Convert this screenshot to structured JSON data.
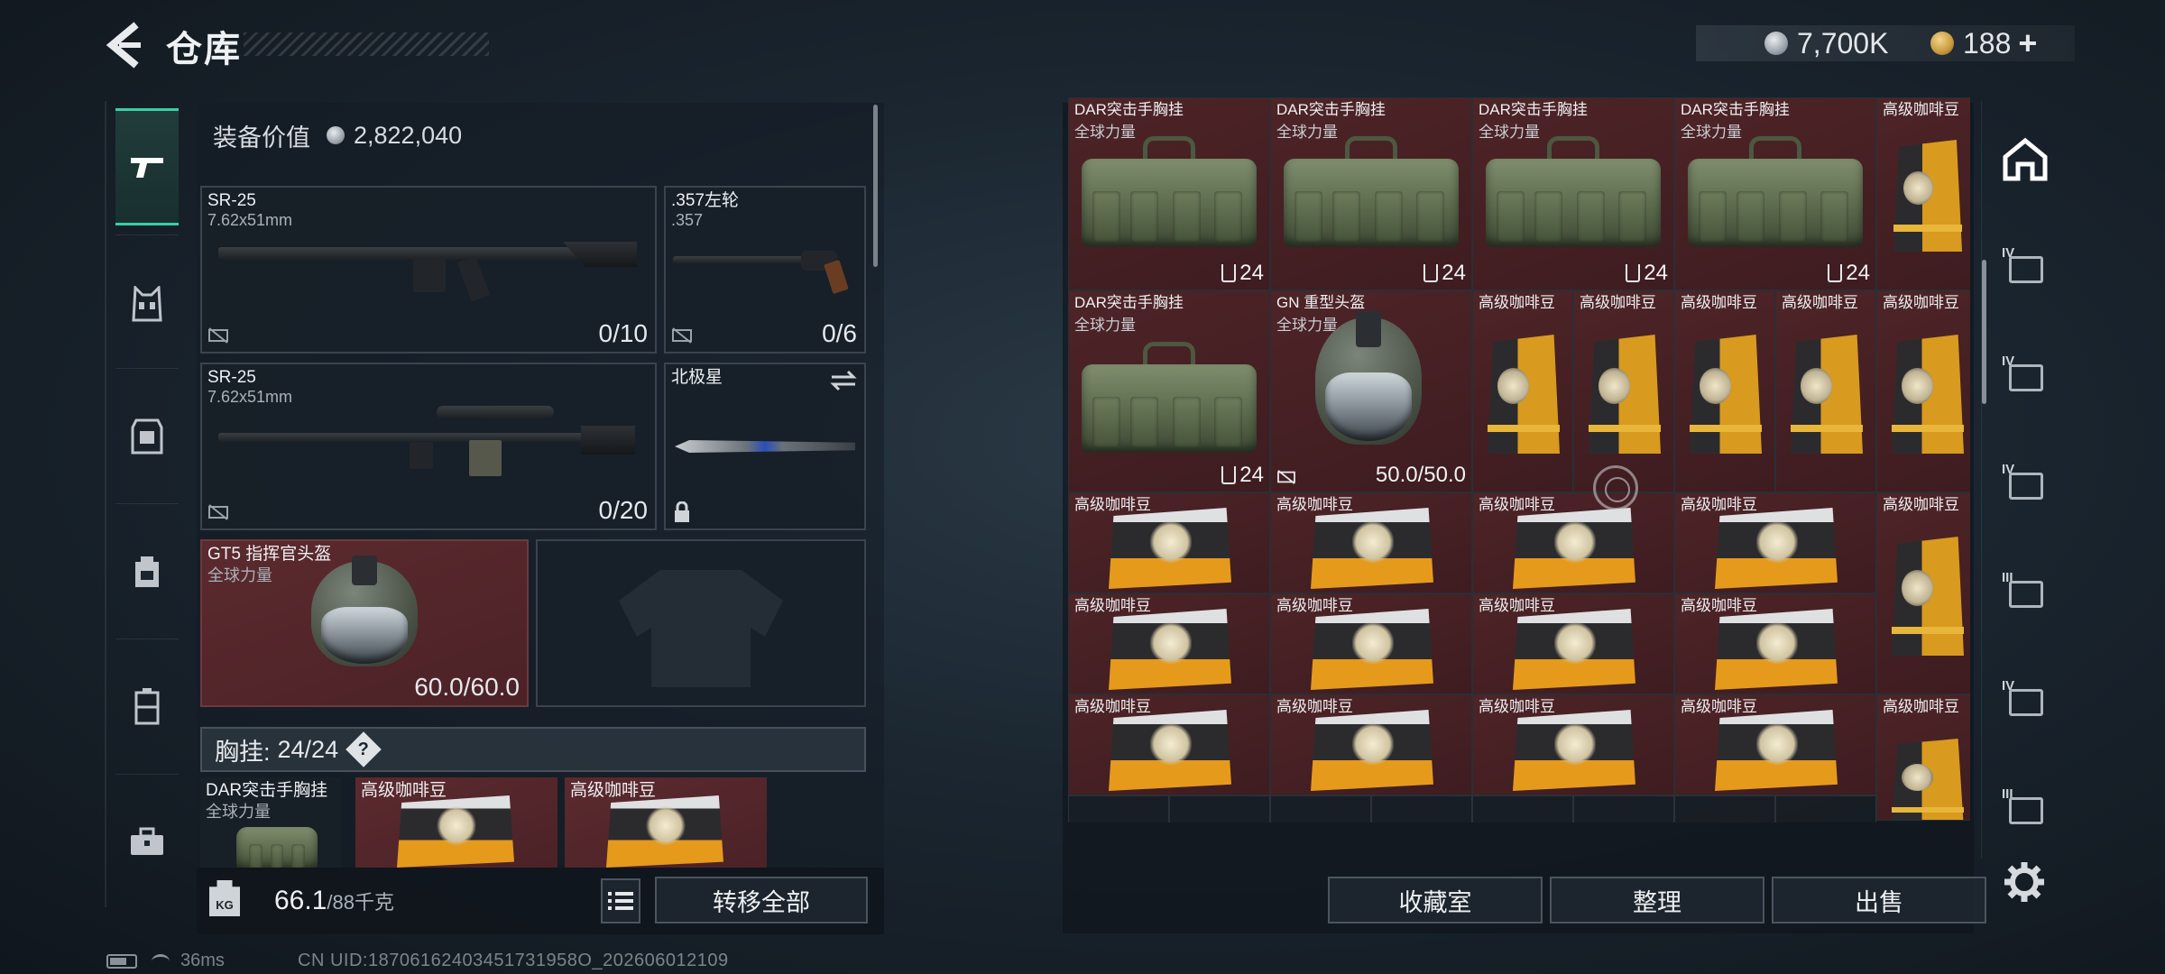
{
  "header": {
    "title": "仓库",
    "currency_silver": "7,700K",
    "currency_gold": "188",
    "plus_symbol": "+"
  },
  "equipment": {
    "value_label": "装备价值",
    "value": "2,822,040",
    "slots": [
      {
        "name": "SR-25",
        "sub": "7.62x51mm",
        "count": "0/10"
      },
      {
        "name": ".357左轮",
        "sub": ".357",
        "count": "0/6"
      },
      {
        "name": "SR-25",
        "sub": "7.62x51mm",
        "count": "0/20"
      },
      {
        "name": "北极星"
      },
      {
        "name": "GT5 指挥官头盔",
        "sub": "全球力量",
        "count": "60.0/60.0"
      }
    ],
    "rig_label": "胸挂:",
    "rig_count": "24/24",
    "rig_help": "?",
    "rig_items": [
      {
        "name": "DAR突击手胸挂",
        "sub": "全球力量"
      },
      {
        "name": "高级咖啡豆"
      },
      {
        "name": "高级咖啡豆"
      }
    ],
    "weight_badge": "KG",
    "weight_value": "66.1",
    "weight_unit": "/88千克",
    "transfer_all": "转移全部"
  },
  "stash": {
    "top_row": [
      {
        "name": "DAR突击手胸挂",
        "sub": "全球力量",
        "count": "24"
      },
      {
        "name": "DAR突击手胸挂",
        "sub": "全球力量",
        "count": "24"
      },
      {
        "name": "DAR突击手胸挂",
        "sub": "全球力量",
        "count": "24"
      },
      {
        "name": "DAR突击手胸挂",
        "sub": "全球力量",
        "count": "24"
      },
      {
        "name": "高级咖啡豆"
      }
    ],
    "row2_rig": {
      "name": "DAR突击手胸挂",
      "sub": "全球力量",
      "count": "24"
    },
    "row2_helmet": {
      "name": "GN 重型头盔",
      "sub": "全球力量",
      "durability": "50.0/50.0"
    },
    "coffee_name": "高级咖啡豆",
    "buttons": {
      "collection": "收藏室",
      "organize": "整理",
      "sell": "出售"
    }
  },
  "right_tabs": [
    {
      "tier": ""
    },
    {
      "tier": "IV"
    },
    {
      "tier": "IV"
    },
    {
      "tier": "IV"
    },
    {
      "tier": "III"
    },
    {
      "tier": "IV"
    },
    {
      "tier": "III"
    }
  ],
  "status": {
    "ping": "36ms",
    "uid": "CN UID:18706162403451731958O_202606012109"
  },
  "colors": {
    "accent": "#37d0a6",
    "item_red": "#4e2427",
    "coffee_orange": "#d89a1f"
  }
}
